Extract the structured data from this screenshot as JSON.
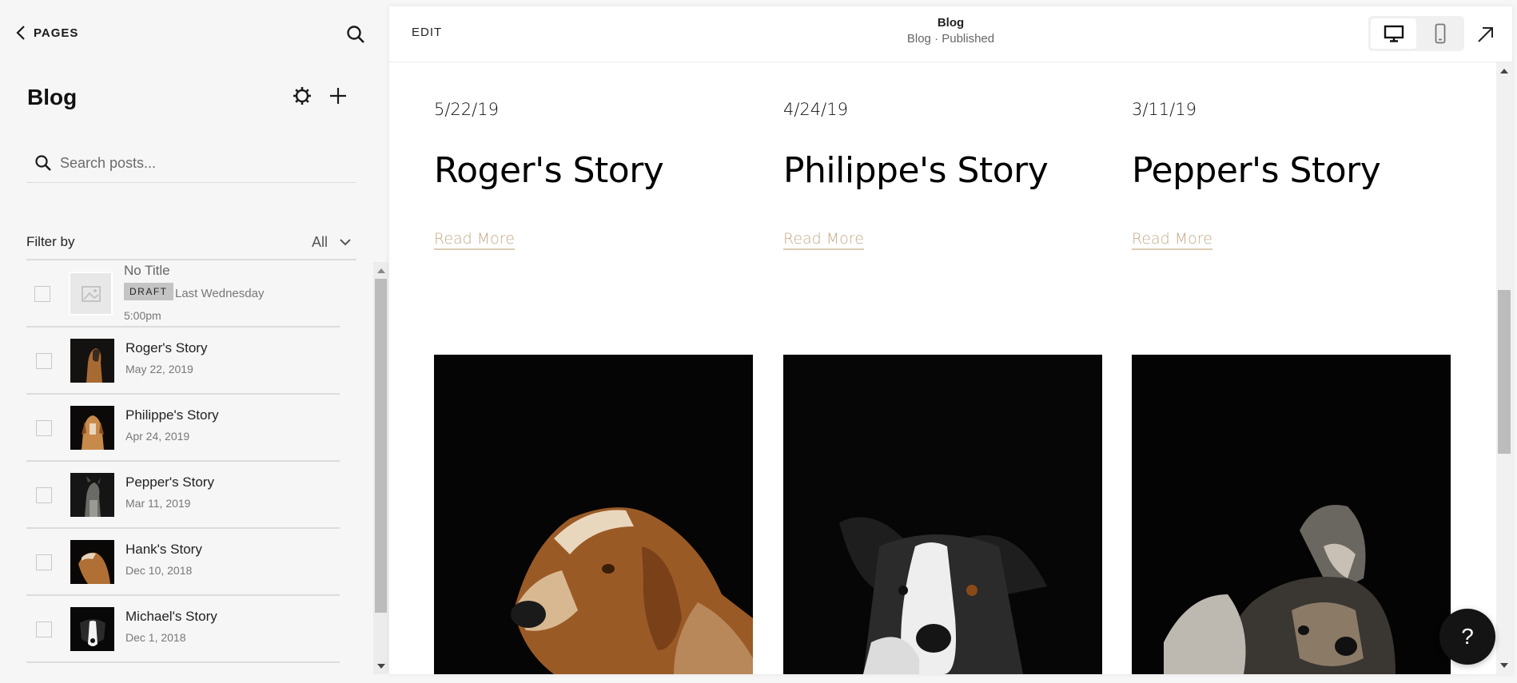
{
  "sidebar": {
    "back_label": "PAGES",
    "title": "Blog",
    "search_placeholder": "Search posts...",
    "filter_label": "Filter by",
    "filter_value": "All",
    "draft_post": {
      "title": "No Title",
      "badge": "DRAFT",
      "when": "Last Wednesday",
      "time": "5:00pm"
    },
    "posts": [
      {
        "title": "Roger's Story",
        "date": "May 22, 2019"
      },
      {
        "title": "Philippe's Story",
        "date": "Apr 24, 2019"
      },
      {
        "title": "Pepper's Story",
        "date": "Mar 11, 2019"
      },
      {
        "title": "Hank's Story",
        "date": "Dec 10, 2018"
      },
      {
        "title": "Michael's Story",
        "date": "Dec 1, 2018"
      }
    ]
  },
  "preview": {
    "edit_label": "EDIT",
    "page_title": "Blog",
    "page_subtitle": "Blog · Published",
    "help_label": "?",
    "posts": [
      {
        "date": "5/22/19",
        "title": "Roger's Story",
        "read_more": "Read More"
      },
      {
        "date": "4/24/19",
        "title": "Philippe's Story",
        "read_more": "Read More"
      },
      {
        "date": "3/11/19",
        "title": "Pepper's Story",
        "read_more": "Read More"
      }
    ]
  },
  "colors": {
    "sidebar_bg": "#f6f6f6",
    "read_more": "#c4a886",
    "draft_badge": "#c4c4c4",
    "help_button": "#141414"
  }
}
